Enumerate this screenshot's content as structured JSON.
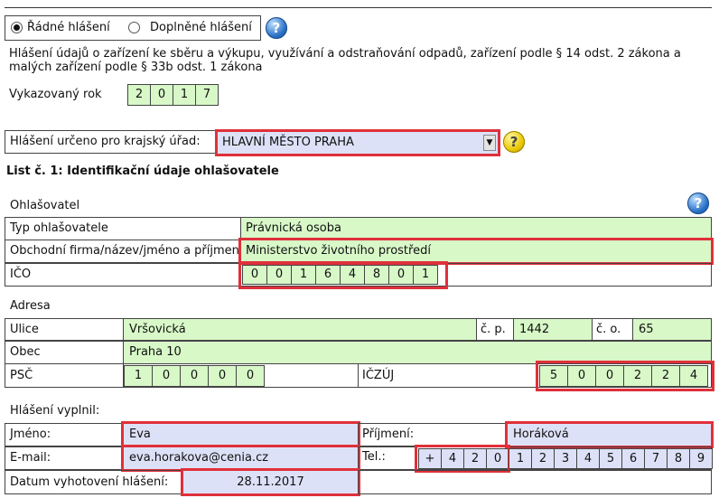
{
  "report_type": {
    "option_regular": "Řádné hlášení",
    "option_supplementary": "Doplněné hlášení",
    "selected": "regular"
  },
  "description": "Hlášení údajů o zařízení ke sběru a výkupu, využívání a odstraňování odpadů, zařízení podle § 14 odst. 2 zákona a malých zařízení podle § 33b odst. 1 zákona",
  "year": {
    "label": "Vykazovaný rok",
    "digits": [
      "2",
      "0",
      "1",
      "7"
    ]
  },
  "region": {
    "label": "Hlášení určeno pro krajský úřad:",
    "value": "HLAVNÍ MĚSTO PRAHA"
  },
  "list1_title": "List č. 1: Identifikační údaje ohlašovatele",
  "reporter": {
    "title": "Ohlašovatel",
    "type_label": "Typ ohlašovatele",
    "type_value": "Právnická osoba",
    "name_label": "Obchodní firma/název/jméno a příjmení",
    "name_value": "Ministerstvo životního prostředí",
    "ico_label": "IČO",
    "ico_digits": [
      "0",
      "0",
      "1",
      "6",
      "4",
      "8",
      "0",
      "1"
    ]
  },
  "address": {
    "title": "Adresa",
    "street_label": "Ulice",
    "street_value": "Vršovická",
    "cp_label": "č. p.",
    "cp_value": "1442",
    "co_label": "č. o.",
    "co_value": "65",
    "city_label": "Obec",
    "city_value": "Praha 10",
    "zip_label": "PSČ",
    "zip_digits": [
      "1",
      "0",
      "0",
      "0",
      "0"
    ],
    "iczuj_label": "IČZÚJ",
    "iczuj_digits": [
      "5",
      "0",
      "0",
      "2",
      "2",
      "4"
    ]
  },
  "filled_by": {
    "title": "Hlášení vyplnil:",
    "first_name_label": "Jméno:",
    "first_name_value": "Eva",
    "last_name_label": "Příjmení:",
    "last_name_value": "Horáková",
    "email_label": "E-mail:",
    "email_value": "eva.horakova@cenia.cz",
    "phone_label": "Tel.:",
    "phone_prefix": [
      "+",
      "4",
      "2",
      "0"
    ],
    "phone_digits": [
      "1",
      "2",
      "3",
      "4",
      "5",
      "6",
      "7",
      "8",
      "9"
    ],
    "date_label": "Datum vyhotovení hlášení:",
    "date_value": "28.11.2017"
  },
  "icons": [
    "help-icon",
    "help-yellow-icon",
    "dropdown-arrow-icon"
  ]
}
